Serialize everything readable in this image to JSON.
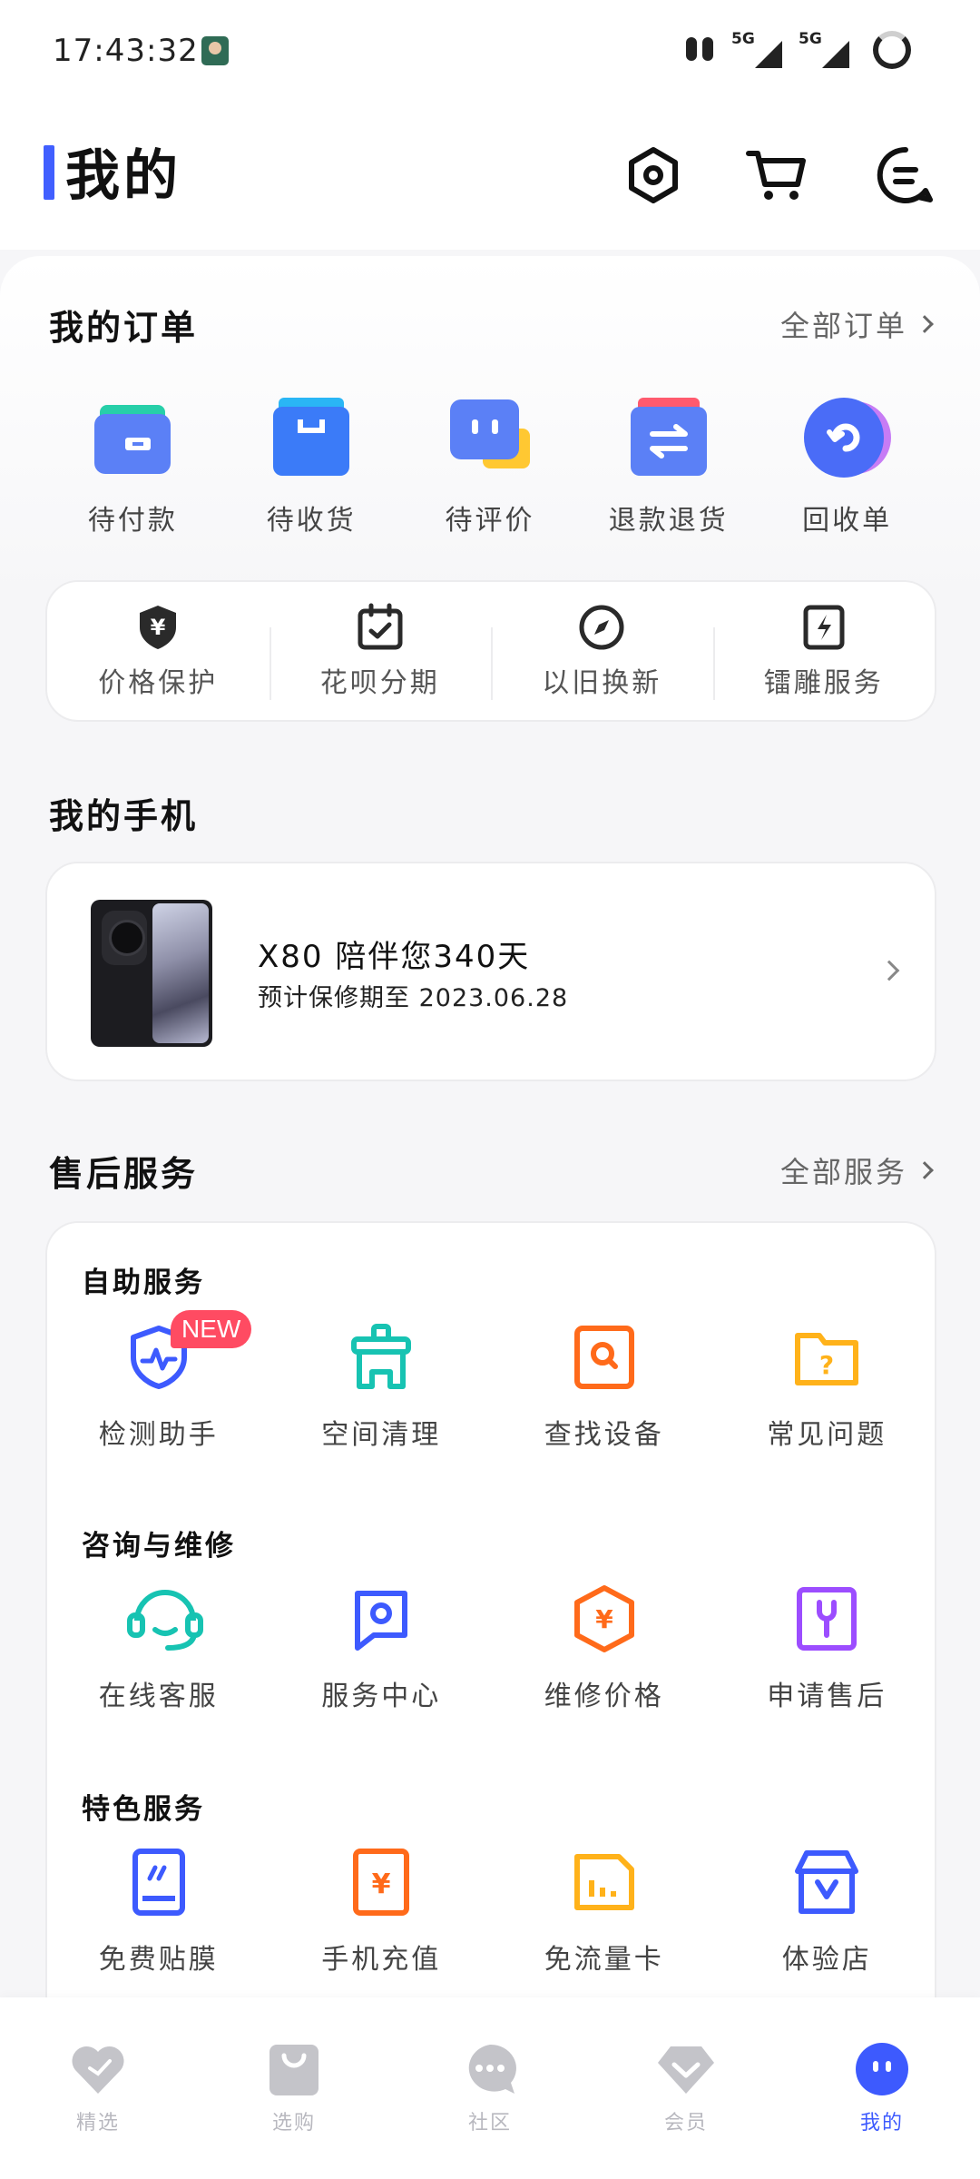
{
  "status_bar": {
    "time": "17:43:32",
    "network_1": "5G",
    "network_2": "5G"
  },
  "header": {
    "title": "我的"
  },
  "orders": {
    "title": "我的订单",
    "all_link": "全部订单",
    "items": [
      {
        "label": "待付款"
      },
      {
        "label": "待收货"
      },
      {
        "label": "待评价"
      },
      {
        "label": "退款退货"
      },
      {
        "label": "回收单"
      }
    ]
  },
  "tools": [
    {
      "label": "价格保护",
      "glyph": "¥"
    },
    {
      "label": "花呗分期"
    },
    {
      "label": "以旧换新"
    },
    {
      "label": "镭雕服务"
    }
  ],
  "my_phone": {
    "title": "我的手机",
    "name": "X80 陪伴您340天",
    "warranty": "预计保修期至 2023.06.28"
  },
  "after_sales": {
    "title": "售后服务",
    "all_link": "全部服务",
    "badge": "NEW",
    "groups": [
      {
        "title": "自助服务",
        "items": [
          {
            "label": "检测助手"
          },
          {
            "label": "空间清理"
          },
          {
            "label": "查找设备"
          },
          {
            "label": "常见问题"
          }
        ]
      },
      {
        "title": "咨询与维修",
        "items": [
          {
            "label": "在线客服"
          },
          {
            "label": "服务中心"
          },
          {
            "label": "维修价格"
          },
          {
            "label": "申请售后"
          }
        ]
      },
      {
        "title": "特色服务",
        "items": [
          {
            "label": "免费贴膜"
          },
          {
            "label": "手机充值"
          },
          {
            "label": "免流量卡"
          },
          {
            "label": "体验店"
          }
        ]
      }
    ],
    "repair_price_glyph": "¥",
    "recharge_glyph": "¥",
    "faq_glyph": "?"
  },
  "tabbar": {
    "items": [
      {
        "label": "精选"
      },
      {
        "label": "选购"
      },
      {
        "label": "社区"
      },
      {
        "label": "会员"
      },
      {
        "label": "我的"
      }
    ]
  },
  "colors": {
    "accent": "#3d5afe",
    "title_bar": "#415fff",
    "badge": "#ff4b62",
    "tab_inactive": "#b8b8bf"
  }
}
